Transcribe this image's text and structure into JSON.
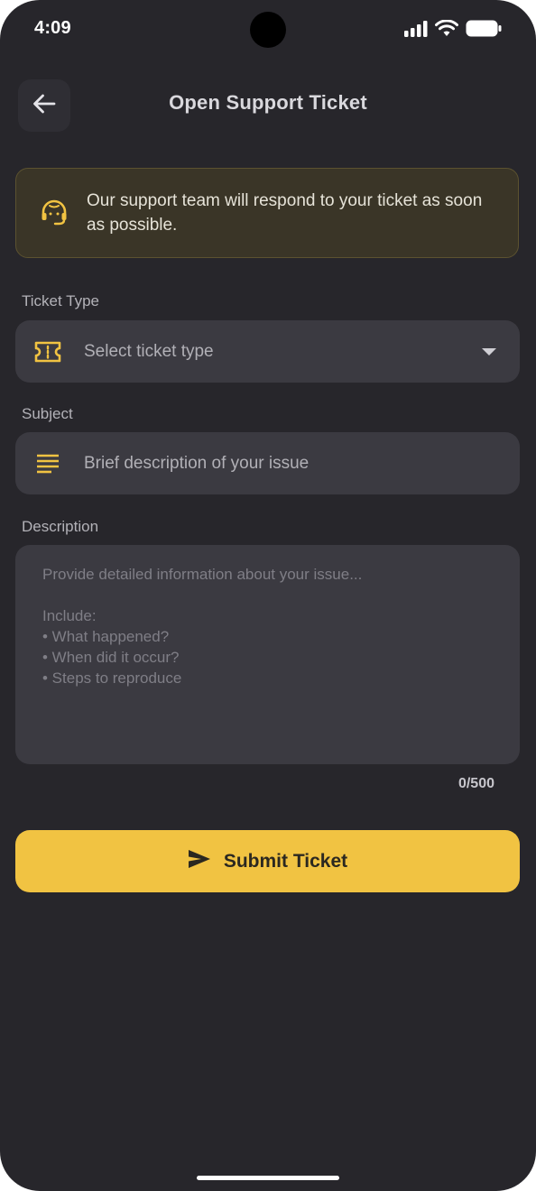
{
  "status_bar": {
    "time": "4:09"
  },
  "header": {
    "title": "Open Support Ticket"
  },
  "banner": {
    "text": "Our support team will respond to your ticket as soon as possible."
  },
  "form": {
    "ticket_type": {
      "label": "Ticket Type",
      "placeholder": "Select ticket type"
    },
    "subject": {
      "label": "Subject",
      "placeholder": "Brief description of your issue"
    },
    "description": {
      "label": "Description",
      "placeholder": "Provide detailed information about your issue...\n\nInclude:\n• What happened?\n• When did it occur?\n• Steps to reproduce",
      "counter": "0/500"
    },
    "submit_label": "Submit Ticket"
  },
  "colors": {
    "background": "#27262b",
    "accent": "#f1c342",
    "field_bg": "#3b3a41",
    "banner_bg": "#3a3527"
  }
}
